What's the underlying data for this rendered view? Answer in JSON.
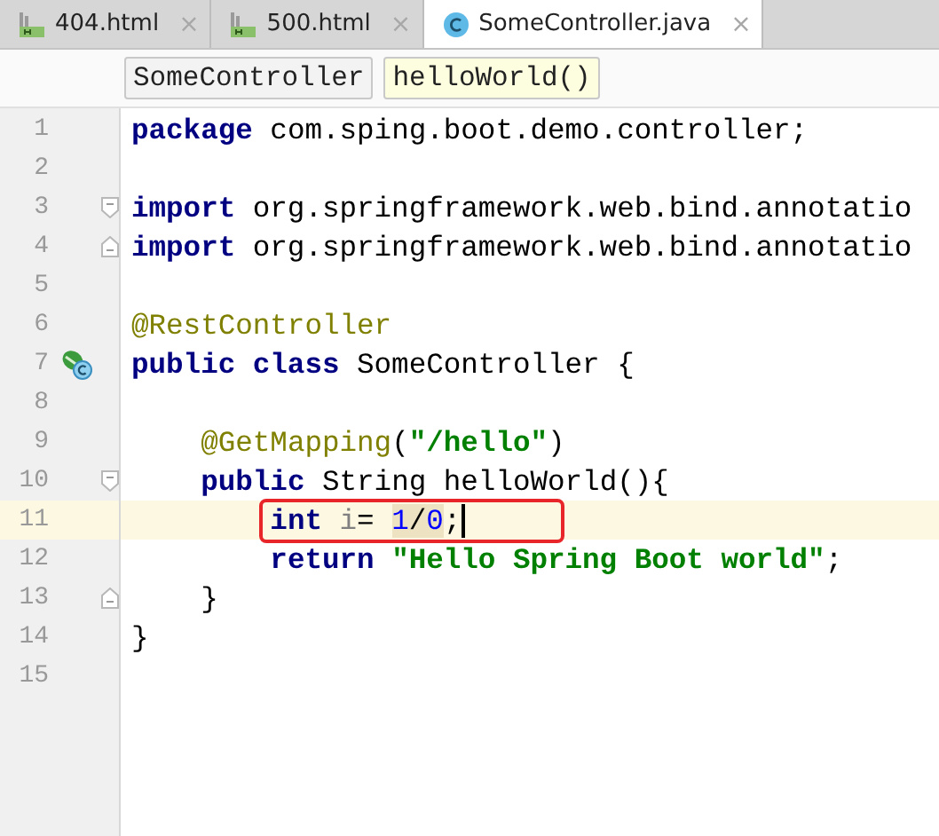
{
  "tabs": [
    {
      "label": "404.html",
      "kind": "html",
      "selected": false,
      "close": "×"
    },
    {
      "label": "500.html",
      "kind": "html",
      "selected": false,
      "close": "×"
    },
    {
      "label": "SomeController.java",
      "kind": "class",
      "selected": true,
      "close": "×"
    }
  ],
  "breadcrumbs": [
    {
      "label": "SomeController",
      "selected": false
    },
    {
      "label": "helloWorld()",
      "selected": true
    }
  ],
  "lines": [
    {
      "number": "1",
      "current": false,
      "tokens": [
        {
          "kind": "keyword",
          "text": "package"
        },
        {
          "kind": "plain",
          "text": " com.sping.boot.demo.controller;"
        }
      ]
    },
    {
      "number": "2",
      "current": false
    },
    {
      "number": "3",
      "current": false,
      "fold_start": true,
      "tokens": [
        {
          "kind": "keyword",
          "text": "import"
        },
        {
          "kind": "plain",
          "text": " org.springframework.web.bind.annotatio"
        }
      ]
    },
    {
      "number": "4",
      "current": false,
      "fold_end": true,
      "tokens": [
        {
          "kind": "keyword",
          "text": "import"
        },
        {
          "kind": "plain",
          "text": " org.springframework.web.bind.annotatio"
        }
      ]
    },
    {
      "number": "5",
      "current": false
    },
    {
      "number": "6",
      "current": false,
      "tokens": [
        {
          "kind": "annotation",
          "text": "@RestController"
        }
      ]
    },
    {
      "number": "7",
      "current": false,
      "gutter_icon": true,
      "tokens": [
        {
          "kind": "keyword",
          "text": "public"
        },
        {
          "kind": "keyword",
          "text": " class"
        },
        {
          "kind": "plain",
          "text": " SomeController {"
        }
      ]
    },
    {
      "number": "8",
      "current": false
    },
    {
      "number": "9",
      "current": false,
      "tokens": [
        {
          "kind": "annotation",
          "text": "    @GetMapping"
        },
        {
          "kind": "plain",
          "text": "("
        },
        {
          "kind": "string",
          "text": "\"/hello\""
        },
        {
          "kind": "plain",
          "text": ")"
        }
      ]
    },
    {
      "number": "10",
      "current": false,
      "fold_start": true,
      "tokens": [
        {
          "kind": "keyword",
          "text": "    public"
        },
        {
          "kind": "plain",
          "text": " String helloWorld(){"
        }
      ]
    },
    {
      "number": "11",
      "current": true,
      "boxed": true,
      "caret": true,
      "tokens": [
        {
          "kind": "keyword",
          "text": "        int"
        },
        {
          "kind": "unused",
          "text": " i"
        },
        {
          "kind": "plain",
          "text": "= "
        },
        {
          "kind": "number",
          "text": "1",
          "highlighted": true
        },
        {
          "kind": "plain",
          "text": "/",
          "highlighted": true
        },
        {
          "kind": "number",
          "text": "0",
          "highlighted": true
        },
        {
          "kind": "plain",
          "text": ";"
        }
      ]
    },
    {
      "number": "12",
      "current": false,
      "tokens": [
        {
          "kind": "keyword",
          "text": "        return"
        },
        {
          "kind": "string",
          "text": " \"Hello Spring Boot world\""
        },
        {
          "kind": "plain",
          "text": ";"
        }
      ]
    },
    {
      "number": "13",
      "current": false,
      "fold_end": true,
      "tokens": [
        {
          "kind": "plain",
          "text": "    }"
        }
      ]
    },
    {
      "number": "14",
      "current": false,
      "tokens": [
        {
          "kind": "plain",
          "text": "}"
        }
      ]
    },
    {
      "number": "15",
      "current": false
    }
  ]
}
